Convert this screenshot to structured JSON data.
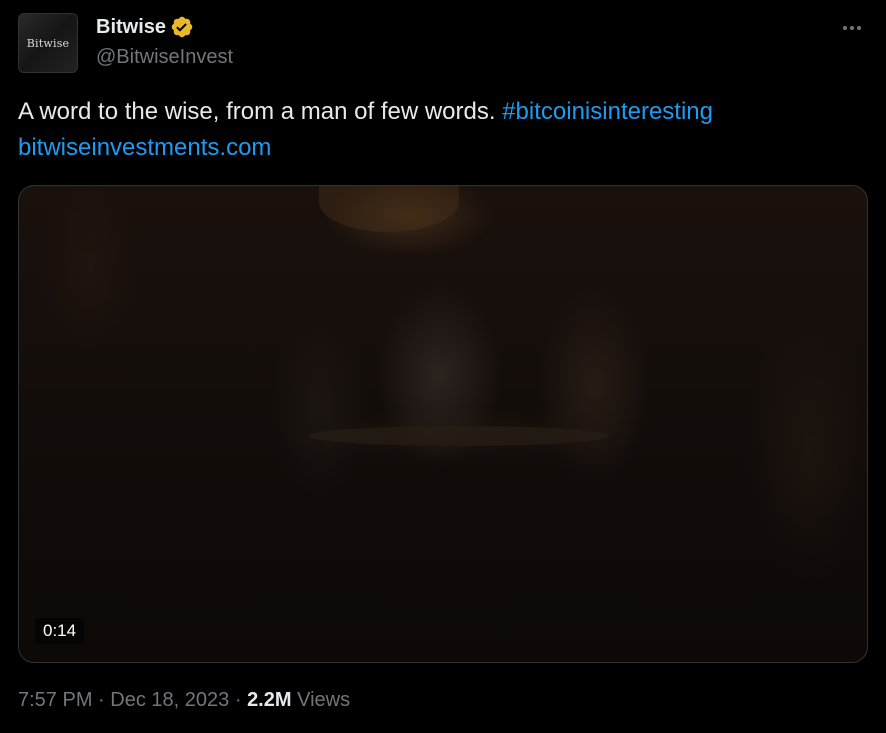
{
  "author": {
    "avatar_text": "Bitwise",
    "display_name": "Bitwise",
    "handle": "@BitwiseInvest",
    "verified_icon": "gold-verified-badge-icon",
    "verified_color": "#e8b829"
  },
  "tweet": {
    "text": "A word to the wise, from a man of few words.",
    "hashtag": "#bitcoinisinteresting",
    "link": "bitwiseinvestments.com"
  },
  "media": {
    "type": "video",
    "duration": "0:14"
  },
  "meta": {
    "time": "7:57 PM",
    "separator": "·",
    "date": "Dec 18, 2023",
    "views_count": "2.2M",
    "views_label": "Views"
  },
  "colors": {
    "background": "#000000",
    "text": "#e7e9ea",
    "secondary": "#71767b",
    "link": "#1d9bf0",
    "border": "#2f3336"
  }
}
